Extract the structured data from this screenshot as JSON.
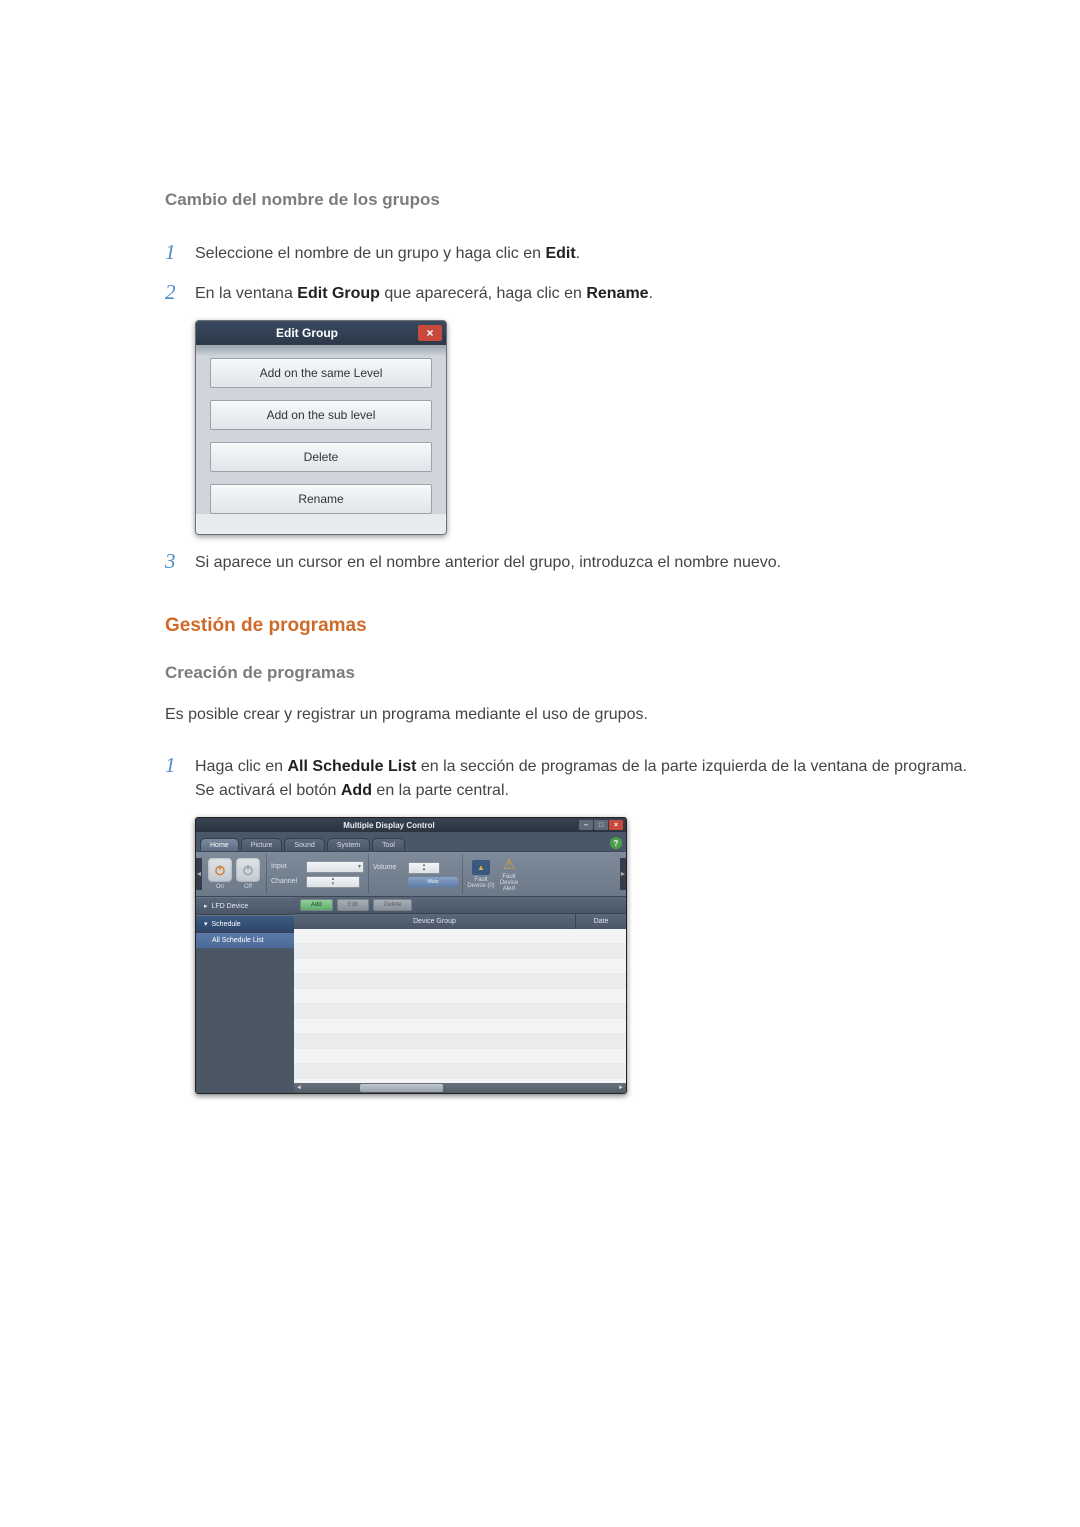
{
  "section1": {
    "heading": "Cambio del nombre de los grupos",
    "steps": [
      {
        "num": "1",
        "prefix": "Seleccione el nombre de un grupo y haga clic en ",
        "bold": "Edit",
        "suffix": "."
      },
      {
        "num": "2",
        "prefix": "En la ventana ",
        "bold": "Edit Group",
        "mid": " que aparecerá, haga clic en ",
        "bold2": "Rename",
        "suffix": "."
      },
      {
        "num": "3",
        "prefix": "Si aparece un cursor en el nombre anterior del grupo, introduzca el nombre nuevo."
      }
    ]
  },
  "dialog": {
    "title": "Edit Group",
    "close": "×",
    "buttons": [
      "Add on the same Level",
      "Add on the sub level",
      "Delete",
      "Rename"
    ]
  },
  "section2": {
    "title": "Gestión de programas",
    "heading": "Creación de programas",
    "intro": "Es posible crear y registrar un programa mediante el uso de grupos.",
    "step": {
      "num": "1",
      "prefix": "Haga clic en ",
      "bold": "All Schedule List",
      "mid": " en la sección de programas de la parte izquierda de la ventana de programa. Se activará el botón ",
      "bold2": "Add",
      "suffix": " en la parte central."
    }
  },
  "app": {
    "title": "Multiple Display Control",
    "winbtns": {
      "min": "–",
      "max": "□",
      "close": "×"
    },
    "tabs": [
      "Home",
      "Picture",
      "Sound",
      "System",
      "Tool"
    ],
    "help": "?",
    "ribbon": {
      "arrow_left": "◄",
      "arrow_right": "►",
      "on": "On",
      "off": "Off",
      "input": "Input",
      "channel": "Channel",
      "volume": "Volume",
      "mute": "Mute",
      "select_caret": "▾",
      "stepper_up": "▴",
      "stepper_dn": "▾",
      "fault_device_0": "Fault Device (0)",
      "fault_alert": "Fault Device Alert"
    },
    "toolbar": {
      "add": "Add",
      "edit": "Edit",
      "delete": "Delete"
    },
    "sidebar": {
      "lfd": "LFD Device",
      "schedule": "Schedule",
      "all_schedule": "All Schedule List",
      "chev_right": "▸",
      "chev_down": "▾"
    },
    "columns": {
      "group": "Device Group",
      "date": "Date"
    }
  }
}
